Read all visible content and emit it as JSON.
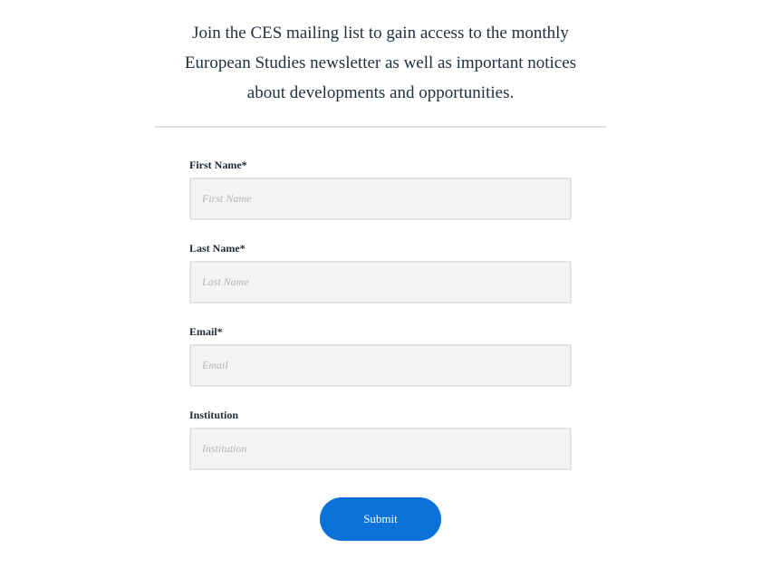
{
  "intro": {
    "line1": "Join the CES mailing list to gain access to the monthly",
    "line2": "European Studies newsletter as well as important notices",
    "line3": "about developments and opportunities."
  },
  "form": {
    "fields": [
      {
        "label": "First Name*",
        "placeholder": "First Name",
        "value": ""
      },
      {
        "label": "Last Name*",
        "placeholder": "Last Name",
        "value": ""
      },
      {
        "label": "Email*",
        "placeholder": "Email",
        "value": ""
      },
      {
        "label": "Institution",
        "placeholder": "Institution",
        "value": ""
      }
    ],
    "submit_label": "Submit"
  },
  "colors": {
    "accent": "#0a72d8",
    "input_bg": "#f4f4f4",
    "text": "#1f2a37"
  }
}
